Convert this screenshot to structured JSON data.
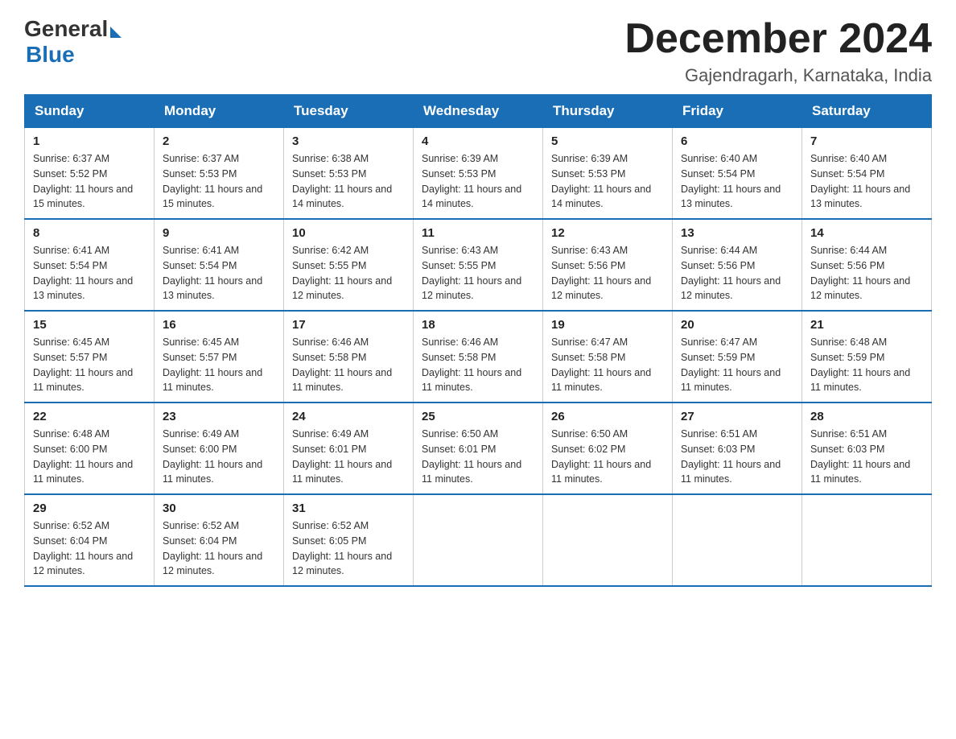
{
  "header": {
    "logo_general": "General",
    "logo_blue": "Blue",
    "month_year": "December 2024",
    "location": "Gajendragarh, Karnataka, India"
  },
  "days_of_week": [
    "Sunday",
    "Monday",
    "Tuesday",
    "Wednesday",
    "Thursday",
    "Friday",
    "Saturday"
  ],
  "weeks": [
    [
      {
        "day": "1",
        "sunrise": "6:37 AM",
        "sunset": "5:52 PM",
        "daylight": "11 hours and 15 minutes."
      },
      {
        "day": "2",
        "sunrise": "6:37 AM",
        "sunset": "5:53 PM",
        "daylight": "11 hours and 15 minutes."
      },
      {
        "day": "3",
        "sunrise": "6:38 AM",
        "sunset": "5:53 PM",
        "daylight": "11 hours and 14 minutes."
      },
      {
        "day": "4",
        "sunrise": "6:39 AM",
        "sunset": "5:53 PM",
        "daylight": "11 hours and 14 minutes."
      },
      {
        "day": "5",
        "sunrise": "6:39 AM",
        "sunset": "5:53 PM",
        "daylight": "11 hours and 14 minutes."
      },
      {
        "day": "6",
        "sunrise": "6:40 AM",
        "sunset": "5:54 PM",
        "daylight": "11 hours and 13 minutes."
      },
      {
        "day": "7",
        "sunrise": "6:40 AM",
        "sunset": "5:54 PM",
        "daylight": "11 hours and 13 minutes."
      }
    ],
    [
      {
        "day": "8",
        "sunrise": "6:41 AM",
        "sunset": "5:54 PM",
        "daylight": "11 hours and 13 minutes."
      },
      {
        "day": "9",
        "sunrise": "6:41 AM",
        "sunset": "5:54 PM",
        "daylight": "11 hours and 13 minutes."
      },
      {
        "day": "10",
        "sunrise": "6:42 AM",
        "sunset": "5:55 PM",
        "daylight": "11 hours and 12 minutes."
      },
      {
        "day": "11",
        "sunrise": "6:43 AM",
        "sunset": "5:55 PM",
        "daylight": "11 hours and 12 minutes."
      },
      {
        "day": "12",
        "sunrise": "6:43 AM",
        "sunset": "5:56 PM",
        "daylight": "11 hours and 12 minutes."
      },
      {
        "day": "13",
        "sunrise": "6:44 AM",
        "sunset": "5:56 PM",
        "daylight": "11 hours and 12 minutes."
      },
      {
        "day": "14",
        "sunrise": "6:44 AM",
        "sunset": "5:56 PM",
        "daylight": "11 hours and 12 minutes."
      }
    ],
    [
      {
        "day": "15",
        "sunrise": "6:45 AM",
        "sunset": "5:57 PM",
        "daylight": "11 hours and 11 minutes."
      },
      {
        "day": "16",
        "sunrise": "6:45 AM",
        "sunset": "5:57 PM",
        "daylight": "11 hours and 11 minutes."
      },
      {
        "day": "17",
        "sunrise": "6:46 AM",
        "sunset": "5:58 PM",
        "daylight": "11 hours and 11 minutes."
      },
      {
        "day": "18",
        "sunrise": "6:46 AM",
        "sunset": "5:58 PM",
        "daylight": "11 hours and 11 minutes."
      },
      {
        "day": "19",
        "sunrise": "6:47 AM",
        "sunset": "5:58 PM",
        "daylight": "11 hours and 11 minutes."
      },
      {
        "day": "20",
        "sunrise": "6:47 AM",
        "sunset": "5:59 PM",
        "daylight": "11 hours and 11 minutes."
      },
      {
        "day": "21",
        "sunrise": "6:48 AM",
        "sunset": "5:59 PM",
        "daylight": "11 hours and 11 minutes."
      }
    ],
    [
      {
        "day": "22",
        "sunrise": "6:48 AM",
        "sunset": "6:00 PM",
        "daylight": "11 hours and 11 minutes."
      },
      {
        "day": "23",
        "sunrise": "6:49 AM",
        "sunset": "6:00 PM",
        "daylight": "11 hours and 11 minutes."
      },
      {
        "day": "24",
        "sunrise": "6:49 AM",
        "sunset": "6:01 PM",
        "daylight": "11 hours and 11 minutes."
      },
      {
        "day": "25",
        "sunrise": "6:50 AM",
        "sunset": "6:01 PM",
        "daylight": "11 hours and 11 minutes."
      },
      {
        "day": "26",
        "sunrise": "6:50 AM",
        "sunset": "6:02 PM",
        "daylight": "11 hours and 11 minutes."
      },
      {
        "day": "27",
        "sunrise": "6:51 AM",
        "sunset": "6:03 PM",
        "daylight": "11 hours and 11 minutes."
      },
      {
        "day": "28",
        "sunrise": "6:51 AM",
        "sunset": "6:03 PM",
        "daylight": "11 hours and 11 minutes."
      }
    ],
    [
      {
        "day": "29",
        "sunrise": "6:52 AM",
        "sunset": "6:04 PM",
        "daylight": "11 hours and 12 minutes."
      },
      {
        "day": "30",
        "sunrise": "6:52 AM",
        "sunset": "6:04 PM",
        "daylight": "11 hours and 12 minutes."
      },
      {
        "day": "31",
        "sunrise": "6:52 AM",
        "sunset": "6:05 PM",
        "daylight": "11 hours and 12 minutes."
      },
      null,
      null,
      null,
      null
    ]
  ]
}
